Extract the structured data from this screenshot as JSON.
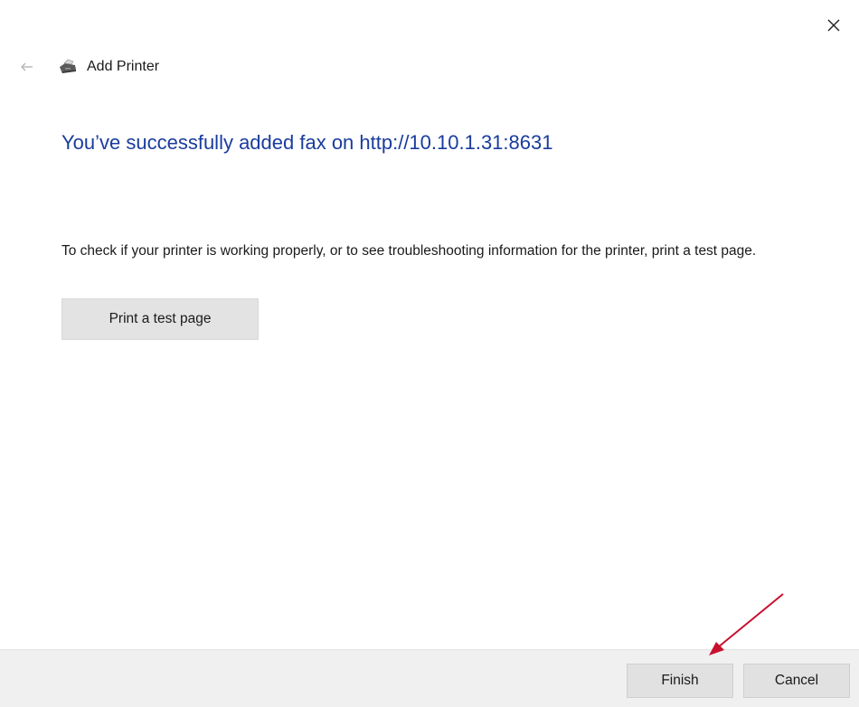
{
  "window": {
    "title": "Add Printer",
    "close_icon": "close-icon",
    "back_icon": "back-arrow-icon",
    "printer_icon": "printer-icon"
  },
  "main": {
    "heading": "You’ve successfully added fax on http://10.10.1.31:8631",
    "description": "To check if your printer is working properly, or to see troubleshooting information for the printer, print a test page.",
    "test_button_label": "Print a test page"
  },
  "footer": {
    "finish_label": "Finish",
    "cancel_label": "Cancel"
  },
  "colors": {
    "heading": "#1a3c9e",
    "annotation_arrow": "#c8102e",
    "footer_background": "#f0f0f0"
  }
}
